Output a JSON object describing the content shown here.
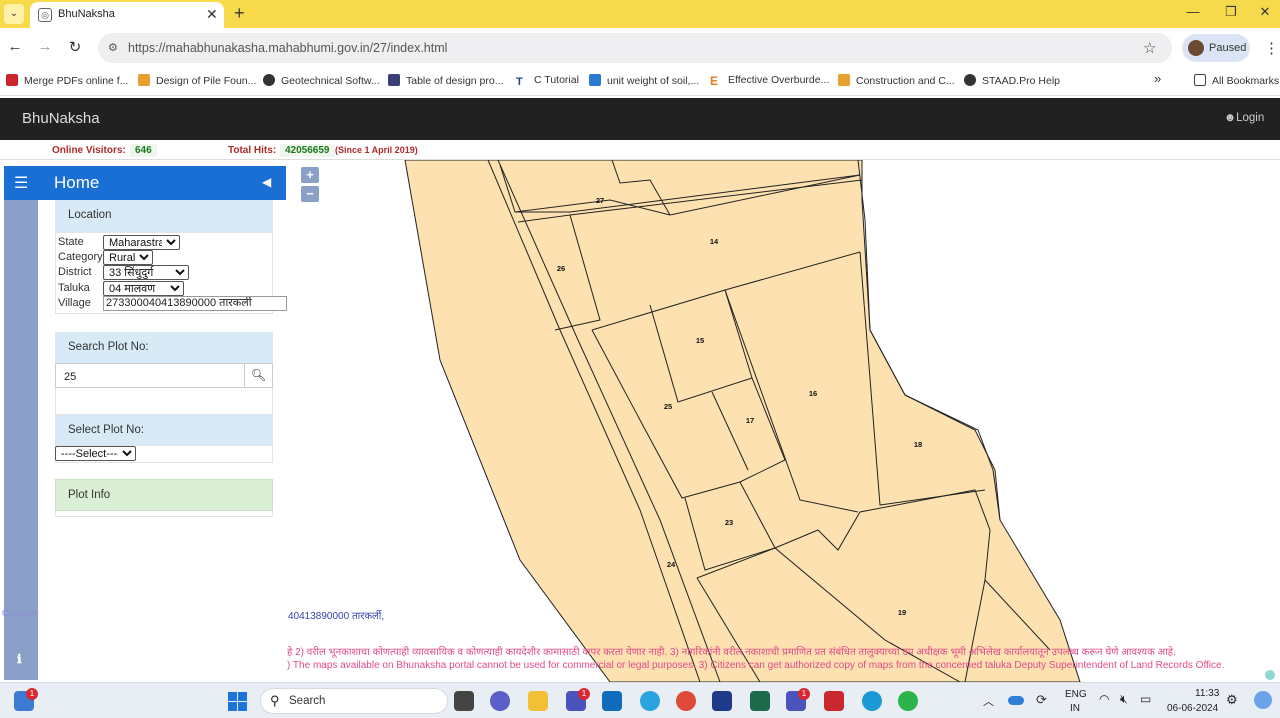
{
  "browser": {
    "tab_title": "BhuNaksha",
    "url": "https://mahabhunakasha.mahabhumi.gov.in/27/index.html",
    "profile_label": "Paused",
    "bookmarks": [
      "Merge PDFs online f...",
      "Design of Pile Foun...",
      "Geotechnical Softw...",
      "Table of design pro...",
      "C Tutorial",
      "unit weight of soil,...",
      "Effective Overburde...",
      "Construction and C...",
      "STAAD.Pro Help"
    ],
    "all_bookmarks_label": "All Bookmarks",
    "chevron_label": "»"
  },
  "app": {
    "brand": "BhuNaksha",
    "login_label": "Login",
    "stats": {
      "visitors_label": "Online Visitors:",
      "visitors_value": "646",
      "hits_label": "Total Hits:",
      "hits_value": "42056659",
      "hits_since": "(Since 1 April 2019)"
    }
  },
  "sidebar": {
    "home_title": "Home",
    "location": {
      "title": "Location",
      "state_label": "State",
      "state_value": "Maharastra",
      "category_label": "Category",
      "category_value": "Rural",
      "district_label": "District",
      "district_value": "33 सिंधुदुर्ग",
      "taluka_label": "Taluka",
      "taluka_value": "04 मालवण",
      "village_label": "Village",
      "village_value": "273300040413890000 तारकर्ली"
    },
    "search": {
      "title": "Search Plot No:",
      "value": "25"
    },
    "select_plot": {
      "title": "Select Plot No:",
      "value": "----Select----"
    },
    "plot_info": {
      "title": "Plot Info"
    }
  },
  "map": {
    "plots": [
      "27",
      "14",
      "26",
      "15",
      "25",
      "16",
      "17",
      "18",
      "23",
      "24",
      "19"
    ],
    "village_caption": "40413890000 तारकर्ली,",
    "notice_marathi": "हे  2) वरील भूनकाशाचा कोणत्याही व्यावसायिक व कोणत्याही कायदेशीर कामासाठी वापर करता येणार नाही. 3) नागरिकांनी वरील नकाशाची प्रमाणित प्रत संबंधित तालुक्याच्या उप अधीक्षक भूमी अभिलेख कार्यालयातून उपलब्ध करून घेणे आवश्यक आहे.",
    "notice_english": ") The maps available on Bhunaksha portal cannot be used for commercial or legal purposes. 3) Citizens can get authorized copy of maps from the concerned taluka Deputy Superintendent of Land Records Office."
  },
  "taskbar": {
    "search_label": "Search",
    "lang_top": "ENG",
    "lang_bottom": "IN",
    "time": "11:33",
    "date": "06-06-2024",
    "badges": [
      "1",
      "1",
      "1"
    ]
  },
  "colors": {
    "tab_strip": "#f7d94c",
    "app_header": "#212121",
    "home_bar": "#1a6fd4",
    "plot_fill": "#fde1b0",
    "notice": "#e04a8a"
  }
}
